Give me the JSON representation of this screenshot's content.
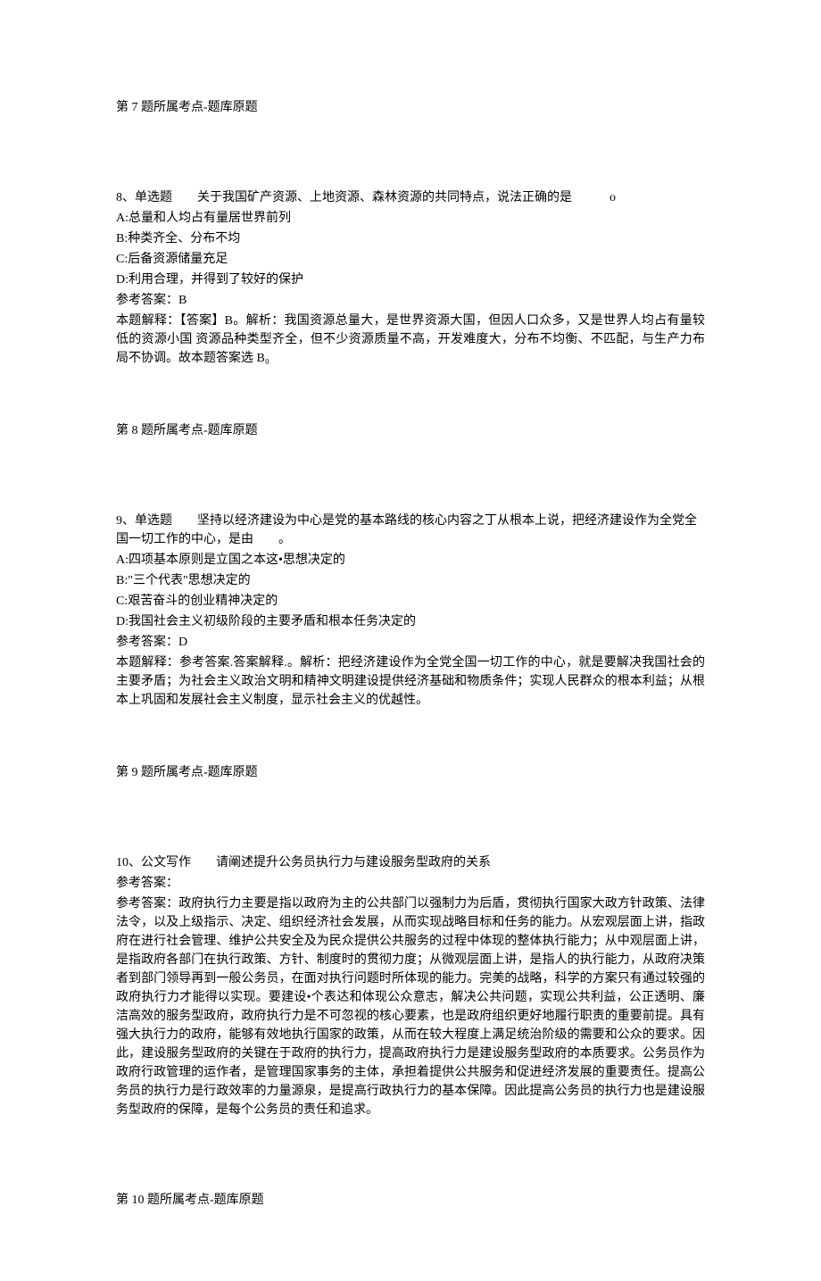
{
  "q7": {
    "topic": "第 7 题所属考点-题库原题"
  },
  "q8": {
    "header": "8、单选题　　关于我国矿产资源、上地资源、森林资源的共同特点，说法正确的是　　　o",
    "optA": "A:总量和人均占有量居世界前列",
    "optB": "B:种类齐全、分布不均",
    "optC": "C:后备资源储量充足",
    "optD": "D:利用合理，并得到了较好的保护",
    "answer": "参考答案：B",
    "explanation": "本题解释：【答案】B。解析：我国资源总量大，是世界资源大国，但因人口众多，又是世界人均占有量较低的资源小国 资源品种类型齐全，但不少资源质量不高，开发难度大，分布不均衡、不匹配，与生产力布局不协调。故本题答案选 B₀",
    "topic": "第 8 题所属考点-题库原题"
  },
  "q9": {
    "header": "9、单选题　　坚持以经济建设为中心是党的基本路线的核心内容之丁从根本上说，把经济建设作为全党全国一切工作的中心，是由　　。",
    "optA": "A:四项基本原则是立国之本这•思想决定的",
    "optB": "B:\"三个代表\"思想决定的",
    "optC": "C:艰苦奋斗的创业精神决定的",
    "optD": "D:我国社会主义初级阶段的主要矛盾和根本任务决定的",
    "answer": "参考答案：D",
    "explanation": "本题解释：参考答案.答案解释.。解析：把经济建设作为全党全国一切工作的中心，就是要解决我国社会的主要矛盾；为社会主义政治文明和精神文明建设提供经济基础和物质条件；实现人民群众的根本利益；从根本上巩固和发展社会主义制度，显示社会主义的优越性。",
    "topic": "第 9 题所属考点-题库原题"
  },
  "q10": {
    "header": "10、公文写作　　请阐述提升公务员执行力与建设服务型政府的关系",
    "answerLabel": "参考答案：",
    "explanation": "参考答案：政府执行力主要是指以政府为主的公共部门以强制力为后盾，贯彻执行国家大政方针政策、法律法令，以及上级指示、决定、组织经济社会发展，从而实现战略目标和任务的能力。从宏观层面上讲，指政府在进行社会管理、维护公共安全及为民众提供公共服务的过程中体现的整体执行能力；从中观层面上讲，是指政府各部门在执行政策、方针、制度时的贯彻力度；从微观层面上讲，是指人的执行能力，从政府决策者到部门领导再到一般公务员，在面对执行问题时所体现的能力。完美的战略，科学的方案只有通过较强的政府执行力才能得以实现。要建设•个表达和体现公众意志，解决公共问题，实现公共利益，公正透明、廉洁高效的服务型政府，政府执行力是不可忽视的核心要素，也是政府组织更好地履行职责的重要前提。具有强大执行力的政府，能够有效地执行国家的政策，从而在较大程度上满足统治阶级的需要和公众的要求。因此，建设服务型政府的关键在于政府的执行力，提高政府执行力是建设服务型政府的本质要求。公务员作为政府行政管理的运作者，是管理国家事务的主体，承担着提供公共服务和促进经济发展的重要责任。提高公务员的执行力是行政效率的力量源泉，是提高行政执行力的基本保障。因此提高公务员的执行力也是建设服务型政府的保障，是每个公务员的责任和追求。",
    "topic": "第 10 题所属考点-题库原题"
  }
}
